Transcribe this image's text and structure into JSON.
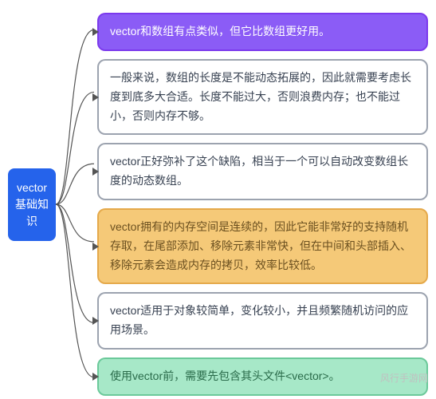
{
  "root": {
    "label": "vector\n基础知识"
  },
  "children": [
    {
      "style": "purple",
      "text": "vector和数组有点类似，但它比数组更好用。"
    },
    {
      "style": "white",
      "text": "一般来说，数组的长度是不能动态拓展的，因此就需要考虑长度到底多大合适。长度不能过大，否则浪费内存；也不能过小，否则内存不够。"
    },
    {
      "style": "white",
      "text": "vector正好弥补了这个缺陷，相当于一个可以自动改变数组长度的动态数组。"
    },
    {
      "style": "yellow",
      "text": "vector拥有的内存空间是连续的，因此它能非常好的支持随机存取，在尾部添加、移除元素非常快，但在中间和头部插入、移除元素会造成内存的拷贝，效率比较低。"
    },
    {
      "style": "white",
      "text": "vector适用于对象较简单，变化较小，并且频繁随机访问的应用场景。"
    },
    {
      "style": "green",
      "text": "使用vector前，需要先包含其头文件<vector>。"
    }
  ],
  "watermark": "风行手游网",
  "colors": {
    "root_bg": "#2563eb",
    "purple_bg": "#8b5cf6",
    "yellow_bg": "#f5c978",
    "green_bg": "#a7e8c8",
    "connector": "#555555"
  }
}
